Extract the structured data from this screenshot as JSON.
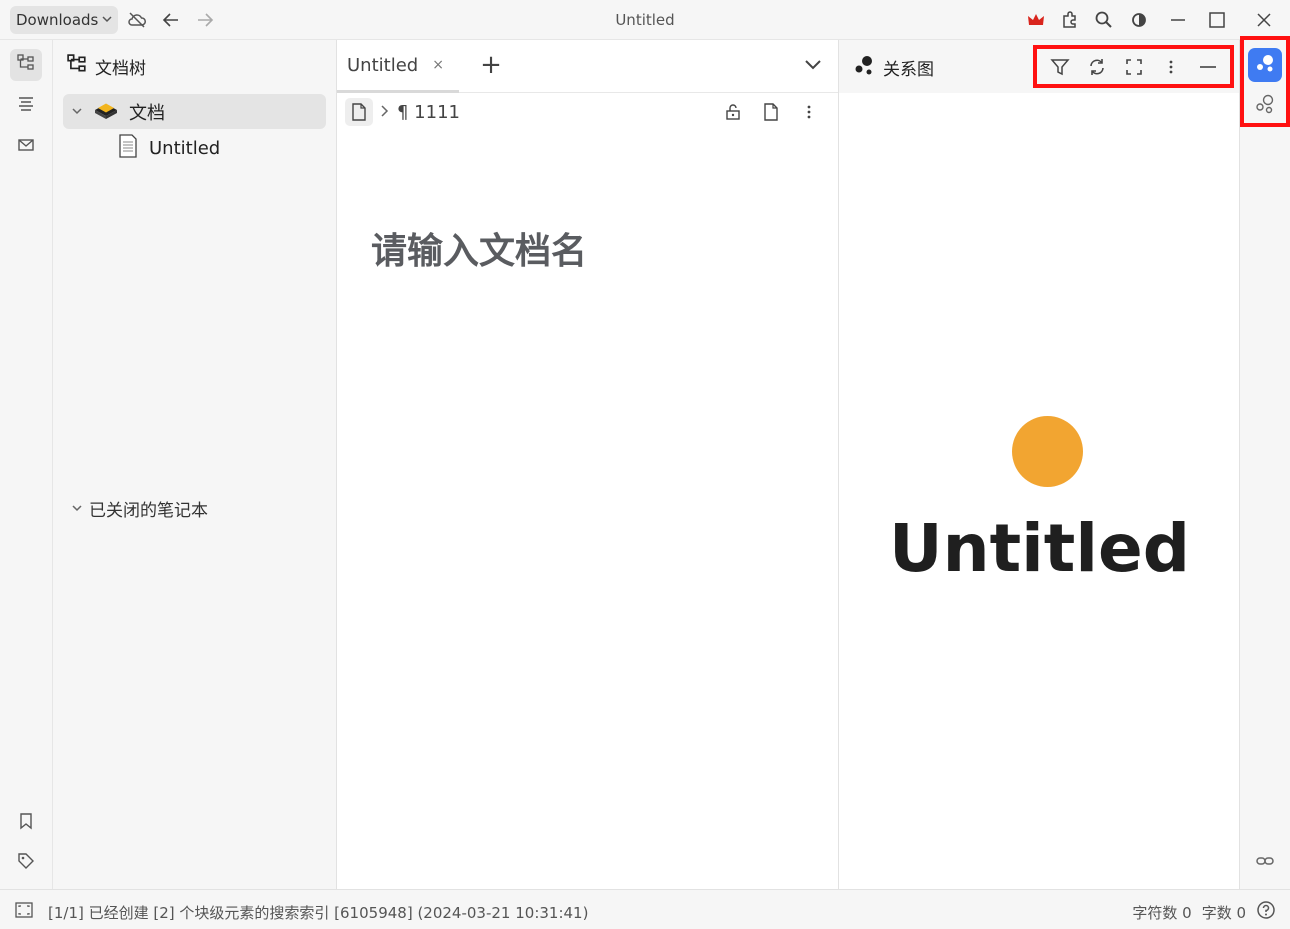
{
  "titlebar": {
    "workspace": "Downloads",
    "title": "Untitled",
    "colors": {
      "crown": "#d9251d"
    }
  },
  "filetree": {
    "header": "文档树",
    "notebook": "文档",
    "doc": "Untitled",
    "closed_section": "已关闭的笔记本"
  },
  "editor": {
    "tab_label": "Untitled",
    "tab_close": "×",
    "tab_add": "+",
    "breadcrumb_block": "¶ 1111",
    "doc_title_placeholder": "请输入文档名"
  },
  "graph": {
    "title": "关系图",
    "node_label": "Untitled",
    "node_color": "#f2a531"
  },
  "rightdock": {
    "active_color": "#3f7bf2"
  },
  "statusbar": {
    "message": "[1/1] 已经创建 [2] 个块级元素的搜索索引 [6105948] (2024-03-21 10:31:41)",
    "char_count": "字符数 0",
    "word_count": "字数 0"
  }
}
